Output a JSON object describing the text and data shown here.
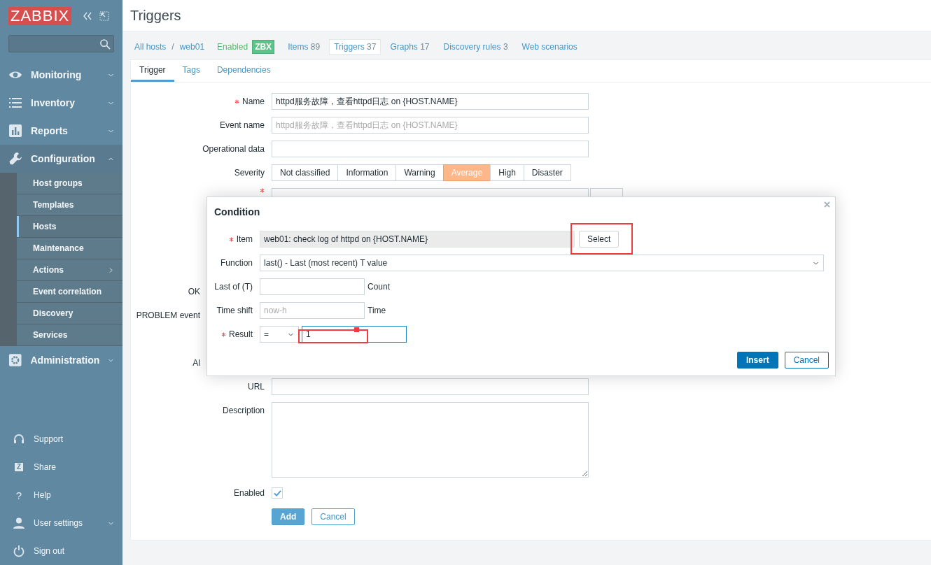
{
  "sidebar": {
    "logo": "ZABBIX",
    "menu": [
      {
        "label": "Monitoring",
        "expanded": false
      },
      {
        "label": "Inventory",
        "expanded": false
      },
      {
        "label": "Reports",
        "expanded": false
      },
      {
        "label": "Configuration",
        "expanded": true,
        "children": [
          {
            "label": "Host groups",
            "selected": false,
            "has_submenu": false
          },
          {
            "label": "Templates",
            "selected": false,
            "has_submenu": false
          },
          {
            "label": "Hosts",
            "selected": true,
            "has_submenu": false
          },
          {
            "label": "Maintenance",
            "selected": false,
            "has_submenu": false
          },
          {
            "label": "Actions",
            "selected": false,
            "has_submenu": true
          },
          {
            "label": "Event correlation",
            "selected": false,
            "has_submenu": false
          },
          {
            "label": "Discovery",
            "selected": false,
            "has_submenu": false
          },
          {
            "label": "Services",
            "selected": false,
            "has_submenu": false
          }
        ]
      },
      {
        "label": "Administration",
        "expanded": false
      }
    ],
    "footer": [
      {
        "label": "Support",
        "expandable": false
      },
      {
        "label": "Share",
        "glyph": "Z",
        "expandable": false
      },
      {
        "label": "Help",
        "glyph": "?",
        "expandable": false
      },
      {
        "label": "User settings",
        "expandable": true
      },
      {
        "label": "Sign out",
        "expandable": false
      }
    ]
  },
  "page": {
    "title": "Triggers"
  },
  "host_nav": {
    "breadcrumbs": [
      "All hosts",
      "web01"
    ],
    "separator": "/",
    "status": "Enabled",
    "badge": "ZBX",
    "tabs": [
      {
        "label": "Items",
        "count": "89",
        "selected": false
      },
      {
        "label": "Triggers",
        "count": "37",
        "selected": true
      },
      {
        "label": "Graphs",
        "count": "17",
        "selected": false
      },
      {
        "label": "Discovery rules",
        "count": "3",
        "selected": false
      },
      {
        "label": "Web scenarios",
        "selected": false
      }
    ]
  },
  "form_tabs": [
    {
      "label": "Trigger",
      "selected": true
    },
    {
      "label": "Tags",
      "selected": false
    },
    {
      "label": "Dependencies",
      "selected": false
    }
  ],
  "form": [
    {
      "kind": "text",
      "label": "Name",
      "required": true,
      "value": "httpd服务故障，查看httpd日志 on {HOST.NAME}"
    },
    {
      "kind": "text",
      "label": "Event name",
      "required": false,
      "placeholder": "httpd服务故障，查看httpd日志 on {HOST.NAME}"
    },
    {
      "kind": "text",
      "label": "Operational data",
      "required": false
    },
    {
      "kind": "severity",
      "label": "Severity",
      "required": false,
      "options": [
        {
          "label": "Not classified",
          "selected": false
        },
        {
          "label": "Information",
          "selected": false
        },
        {
          "label": "Warning",
          "selected": false
        },
        {
          "label": "Average",
          "selected": true
        },
        {
          "label": "High",
          "selected": false
        },
        {
          "label": "Disaster",
          "selected": false
        }
      ]
    },
    {
      "kind": "expression",
      "required": true
    },
    {
      "kind": "covered",
      "label": "OK",
      "required": false
    },
    {
      "kind": "covered",
      "label": "PROBLEM event",
      "required": false
    },
    {
      "kind": "covered",
      "label": "Al",
      "required": false
    },
    {
      "kind": "text",
      "label": "URL",
      "required": false
    },
    {
      "kind": "textarea",
      "label": "Description",
      "required": false
    },
    {
      "kind": "checkbox",
      "label": "Enabled",
      "required": false,
      "checked": true
    }
  ],
  "form_buttons": [
    {
      "label": "Add",
      "kind": "primary"
    },
    {
      "label": "Cancel",
      "kind": "secondary"
    }
  ],
  "dialog": {
    "title": "Condition",
    "rows": [
      {
        "kind": "item",
        "label": "Item",
        "required": true,
        "value": "web01: check log of httpd on {HOST.NAME}",
        "button": "Select"
      },
      {
        "kind": "select",
        "label": "Function",
        "required": false,
        "value": "last() - Last (most recent) T value"
      },
      {
        "kind": "input",
        "label": "Last of (T)",
        "required": false,
        "suffix": "Count"
      },
      {
        "kind": "input",
        "label": "Time shift",
        "required": false,
        "placeholder": "now-h",
        "suffix": "Time"
      },
      {
        "kind": "result",
        "label": "Result",
        "required": true,
        "operator": "=",
        "value": "1"
      }
    ],
    "buttons": [
      {
        "label": "Insert",
        "kind": "primary"
      },
      {
        "label": "Cancel",
        "kind": "secondary"
      }
    ],
    "markup_boxes": [
      {
        "kind": "box"
      },
      {
        "kind": "box_with_handle"
      }
    ]
  }
}
